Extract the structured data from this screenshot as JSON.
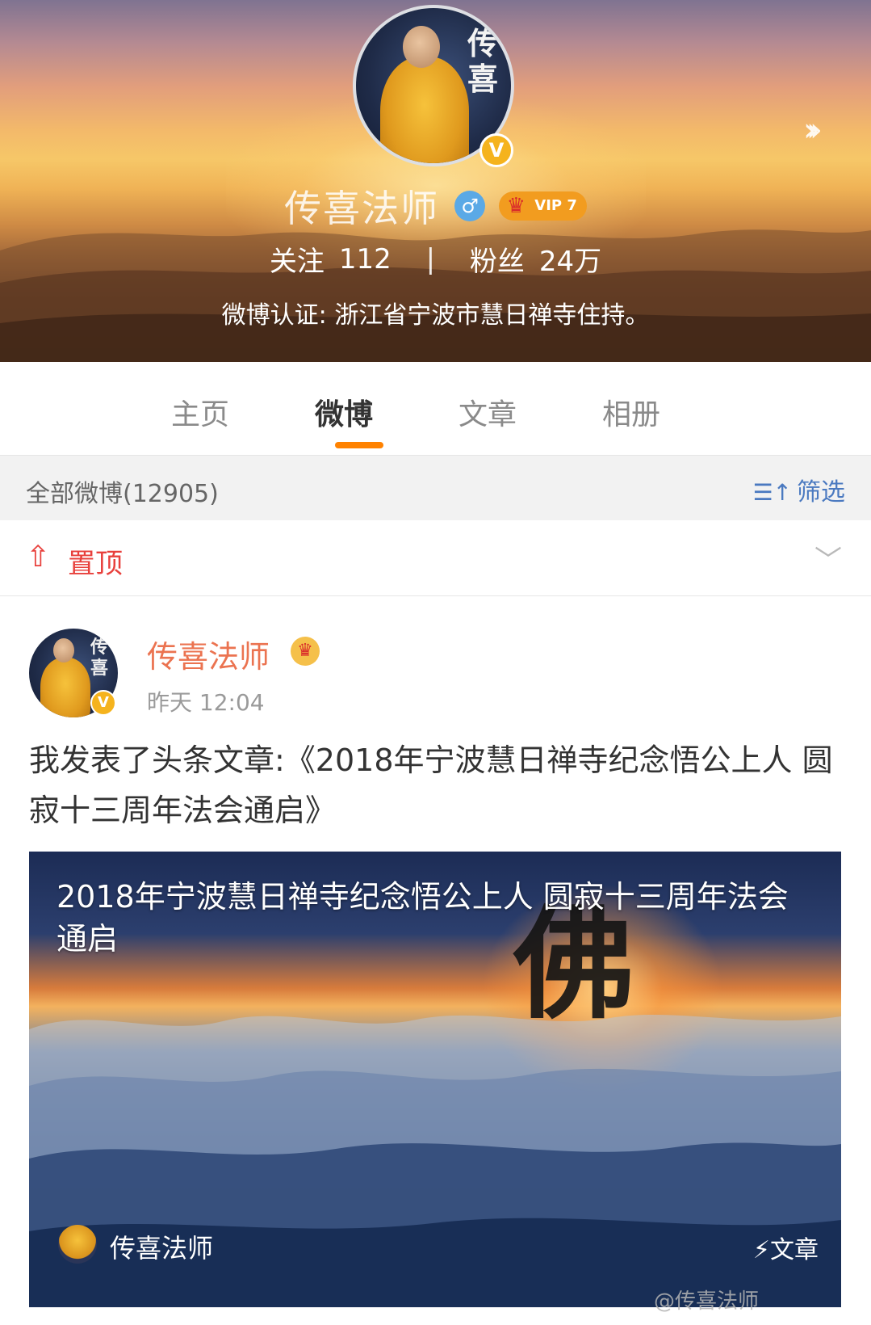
{
  "profile": {
    "name": "传喜法师",
    "gender_symbol": "♂",
    "vip_label": "VIP 7",
    "follow_label": "关注",
    "follow_count": "112",
    "stats_separator": "|",
    "fans_label": "粉丝",
    "fans_count": "24万",
    "certification": "微博认证: 浙江省宁波市慧日禅寺住持。",
    "avatar_calligraphy": "传喜",
    "verified_mark": "V"
  },
  "tabs": [
    {
      "label": "主页",
      "active": false
    },
    {
      "label": "微博",
      "active": true
    },
    {
      "label": "文章",
      "active": false
    },
    {
      "label": "相册",
      "active": false
    }
  ],
  "filter_bar": {
    "count_text": "全部微博(12905)",
    "filter_label": "筛选"
  },
  "pinned": {
    "label": "置顶"
  },
  "post": {
    "author": "传喜法师",
    "time": "昨天 12:04",
    "text": "我发表了头条文章:《2018年宁波慧日禅寺纪念悟公上人 圆寂十三周年法会通启》",
    "article": {
      "title": "2018年宁波慧日禅寺纪念悟公上人 圆寂十三周年法会通启",
      "big_character": "佛",
      "author": "传喜法师",
      "tag": "文章"
    }
  },
  "watermark": "@传喜法师",
  "icons": {
    "more": "chevrons-right-icon",
    "gender": "male-icon",
    "vip": "crown-icon",
    "filter": "filter-icon",
    "pin": "pin-icon",
    "expand": "chevron-down-icon",
    "article_tag": "lightning-icon"
  },
  "colors": {
    "accent_orange": "#ff8200",
    "name_orange": "#eb7350",
    "pin_red": "#e8403c",
    "link_blue": "#4a79c0",
    "verified_yellow": "#f5b31d"
  }
}
